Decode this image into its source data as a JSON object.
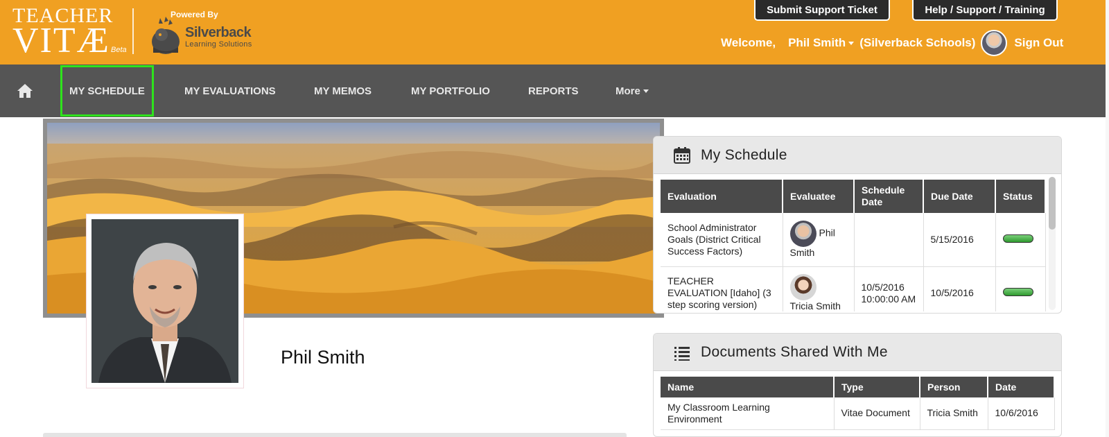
{
  "logo": {
    "line1": "TEACHER",
    "line2": "VITÆ",
    "beta": "Beta"
  },
  "powered": {
    "label": "Powered By",
    "brand": "Silverback",
    "tagline": "Learning Solutions"
  },
  "top_buttons": {
    "ticket": "Submit Support Ticket",
    "help": "Help / Support / Training"
  },
  "user_bar": {
    "welcome": "Welcome,",
    "user_name": "Phil Smith",
    "school": "(Silverback Schools)",
    "sign_out": "Sign Out"
  },
  "nav": {
    "items": [
      {
        "label": "MY SCHEDULE",
        "active": true
      },
      {
        "label": "MY EVALUATIONS"
      },
      {
        "label": "MY MEMOS"
      },
      {
        "label": "MY PORTFOLIO"
      },
      {
        "label": "REPORTS"
      },
      {
        "label": "More"
      }
    ]
  },
  "profile": {
    "name": "Phil Smith"
  },
  "schedule": {
    "title": "My Schedule",
    "columns": [
      "Evaluation",
      "Evaluatee",
      "Schedule Date",
      "Due Date",
      "Status"
    ],
    "rows": [
      {
        "evaluation": "School Administrator Goals (District Critical Success Factors)",
        "evaluatee": "Phil Smith",
        "schedule_date": "",
        "due_date": "5/15/2016",
        "status": "active"
      },
      {
        "evaluation": "TEACHER EVALUATION [Idaho] (3 step scoring version)",
        "evaluatee": "Tricia Smith",
        "schedule_date": "10/5/2016 10:00:00 AM",
        "due_date": "10/5/2016",
        "status": "active"
      }
    ]
  },
  "documents": {
    "title": "Documents Shared With Me",
    "columns": [
      "Name",
      "Type",
      "Person",
      "Date"
    ],
    "rows": [
      {
        "name": "My Classroom Learning Environment",
        "type": "Vitae Document",
        "person": "Tricia Smith",
        "date": "10/6/2016"
      }
    ]
  },
  "colors": {
    "header": "#f0a022",
    "nav": "#555555",
    "active_outline": "#2ee31c",
    "table_head": "#4a4a4a"
  }
}
